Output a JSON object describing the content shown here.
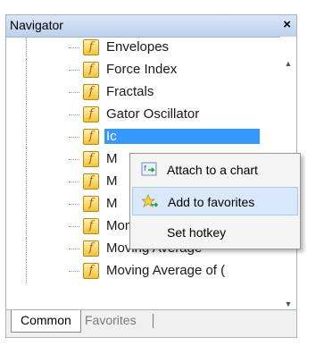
{
  "navigator": {
    "title": "Navigator",
    "close_glyph": "×",
    "items": [
      {
        "label": "Envelopes"
      },
      {
        "label": "Force Index"
      },
      {
        "label": "Fractals"
      },
      {
        "label": "Gator Oscillator"
      },
      {
        "label": "Ic",
        "selected": true
      },
      {
        "label": "M"
      },
      {
        "label": "M"
      },
      {
        "label": "M"
      },
      {
        "label": "Money Flow Index"
      },
      {
        "label": "Moving Average"
      },
      {
        "label": "Moving Average of ("
      }
    ],
    "item_icon": "function-icon",
    "item_icon_glyph": "f",
    "tabs": [
      {
        "label": "Common",
        "active": true
      },
      {
        "label": "Favorites",
        "active": false
      }
    ],
    "scroll_up_glyph": "▲",
    "scroll_down_glyph": "▼"
  },
  "context_menu": {
    "items": [
      {
        "label": "Attach to a chart",
        "icon": "attach-chart-icon"
      },
      {
        "label": "Add to favorites",
        "icon": "favorites-star-icon",
        "highlighted": true
      },
      {
        "label": "Set hotkey",
        "icon": ""
      }
    ]
  },
  "colors": {
    "selection": "#3399ff",
    "menu_highlight": "#d9e9fb",
    "icon_fill": "#f1c33a"
  }
}
